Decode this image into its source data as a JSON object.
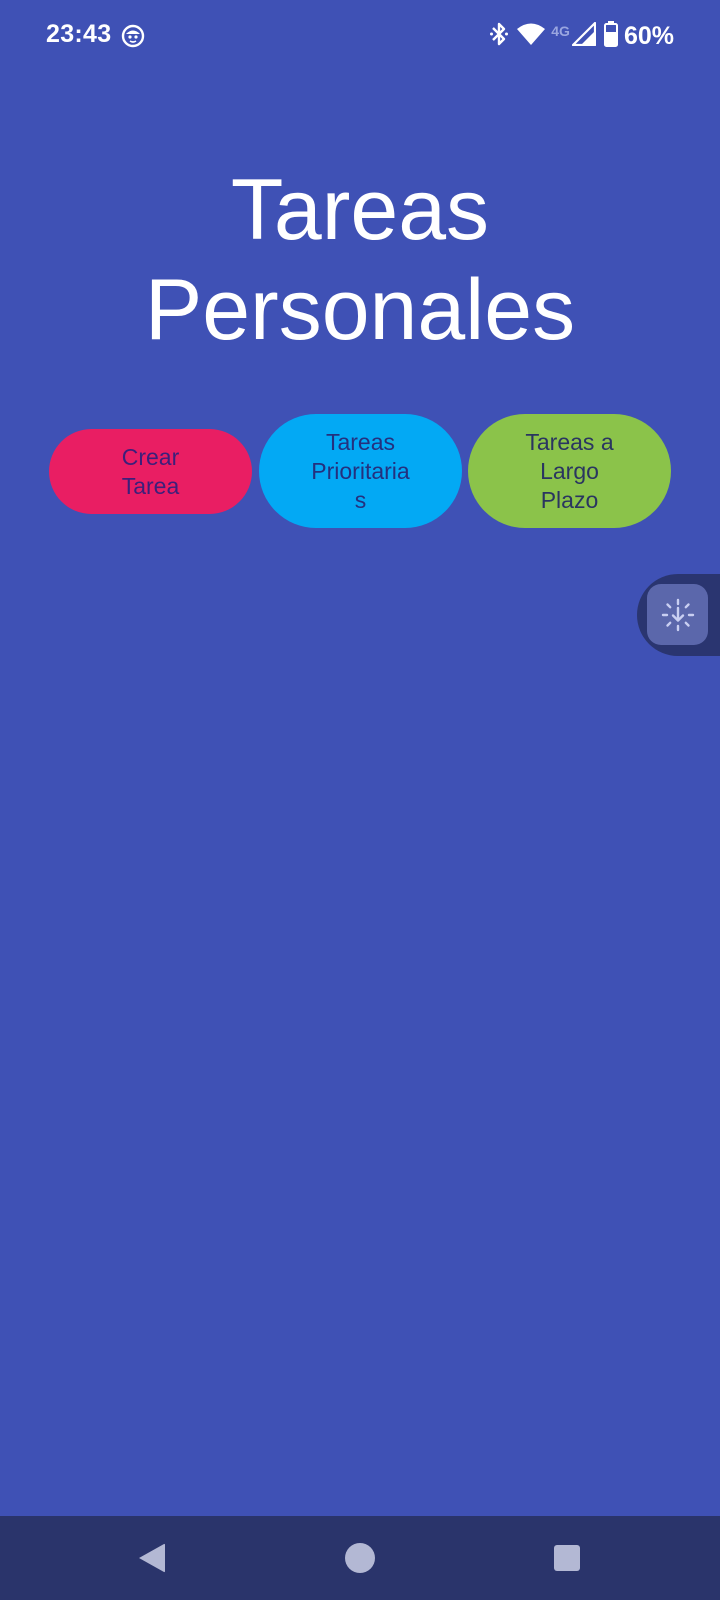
{
  "status_bar": {
    "time": "23:43",
    "notification_icon": "face-icon",
    "network_type": "4G",
    "battery_percent": "60%"
  },
  "title": {
    "line1": "Tareas",
    "line2": "Personales"
  },
  "buttons": {
    "create": {
      "line1": "Crear",
      "line2": "Tarea",
      "color": "#e91e63"
    },
    "priority": {
      "line1": "Tareas",
      "line2": "Prioritaria",
      "line3": "s",
      "color": "#03a9f4"
    },
    "longterm": {
      "line1": "Tareas a",
      "line2": "Largo",
      "line3": "Plazo",
      "color": "#8bc34a"
    }
  },
  "side_handle": {
    "icon": "touch-download-icon"
  },
  "nav_bar": {
    "back_icon": "back-triangle-icon",
    "home_icon": "home-circle-icon",
    "recents_icon": "recents-square-icon"
  },
  "colors": {
    "background": "#3f51b5",
    "nav_bar": "#2a346b"
  }
}
